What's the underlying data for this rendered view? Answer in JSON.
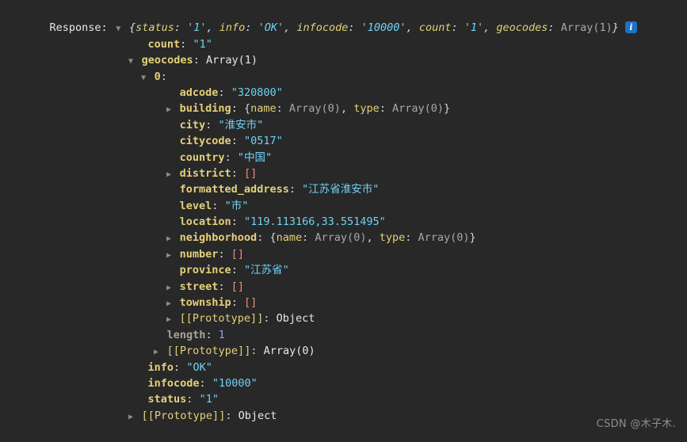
{
  "console": {
    "label": "Response:",
    "info_icon_glyph": "i",
    "colors": {
      "background": "#282828",
      "key": "#e4d07a",
      "string": "#6fd2f5",
      "number": "#a694f5",
      "empty_array": "#f08c7a",
      "neutral": "#e8e8e8",
      "dim": "#a8a8a8",
      "info_badge": "#1a73c7"
    },
    "preview": {
      "open_brace": "{",
      "entries": [
        {
          "key": "status",
          "sep": ": ",
          "value": "'1'",
          "tail": ", "
        },
        {
          "key": "info",
          "sep": ": ",
          "value": "'OK'",
          "tail": ", "
        },
        {
          "key": "infocode",
          "sep": ": ",
          "value": "'10000'",
          "tail": ", "
        },
        {
          "key": "count",
          "sep": ": ",
          "value": "'1'",
          "tail": ", "
        }
      ],
      "last_key": "geocodes",
      "last_sep": ": ",
      "last_value": "Array(1)",
      "close_brace": "}"
    },
    "rows": [
      {
        "key": "count",
        "value": "\"1\""
      },
      {
        "key": "geocodes",
        "value": "Array(1)"
      },
      {
        "key": "0",
        "value": ""
      },
      {
        "key": "adcode",
        "value": "\"320800\""
      },
      {
        "key": "building",
        "value": ""
      },
      {
        "key": "city",
        "value": "\"淮安市\""
      },
      {
        "key": "citycode",
        "value": "\"0517\""
      },
      {
        "key": "country",
        "value": "\"中国\""
      },
      {
        "key": "district",
        "value": "[]"
      },
      {
        "key": "formatted_address",
        "value": "\"江苏省淮安市\""
      },
      {
        "key": "level",
        "value": "\"市\""
      },
      {
        "key": "location",
        "value": "\"119.113166,33.551495\""
      },
      {
        "key": "neighborhood",
        "value": ""
      },
      {
        "key": "number",
        "value": "[]"
      },
      {
        "key": "province",
        "value": "\"江苏省\""
      },
      {
        "key": "street",
        "value": "[]"
      },
      {
        "key": "township",
        "value": "[]"
      },
      {
        "key": "[[Prototype]]",
        "value": "Object"
      },
      {
        "key": "length",
        "value": "1"
      },
      {
        "key": "[[Prototype]]",
        "value": "Array(0)"
      },
      {
        "key": "info",
        "value": "\"OK\""
      },
      {
        "key": "infocode",
        "value": "\"10000\""
      },
      {
        "key": "status",
        "value": "\"1\""
      },
      {
        "key": "[[Prototype]]",
        "value": "Object"
      }
    ],
    "object_previews": {
      "building": {
        "open": "{",
        "k1": "name",
        "v1": "Array(0)",
        "sep": ", ",
        "k2": "type",
        "v2": "Array(0)",
        "close": "}"
      },
      "neighborhood": {
        "open": "{",
        "k1": "name",
        "v1": "Array(0)",
        "sep": ", ",
        "k2": "type",
        "v2": "Array(0)",
        "close": "}"
      }
    },
    "colon": ":",
    "watermark": "CSDN @木子木."
  }
}
